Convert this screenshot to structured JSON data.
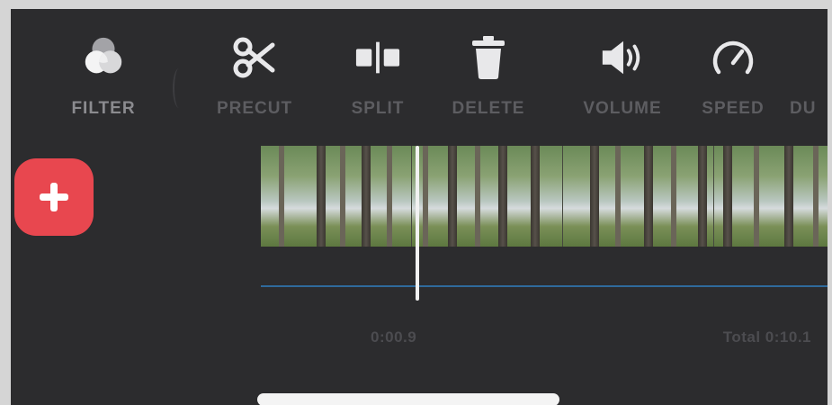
{
  "toolbar": {
    "tools": [
      {
        "label": "FILTER",
        "icon": "filter-icon"
      },
      {
        "label": "PRECUT",
        "icon": "scissors-icon"
      },
      {
        "label": "SPLIT",
        "icon": "split-icon"
      },
      {
        "label": "DELETE",
        "icon": "trash-icon"
      },
      {
        "label": "VOLUME",
        "icon": "speaker-icon"
      },
      {
        "label": "SPEED",
        "icon": "speedometer-icon"
      },
      {
        "label": "DU",
        "icon": "duration-icon"
      }
    ]
  },
  "add_button": {
    "icon": "plus-icon",
    "color": "#e8474f"
  },
  "timeline": {
    "current_time": "0:00.9",
    "total_time": "Total 0:10.1",
    "playhead_color": "#f2f2f2",
    "track_color": "#2f6a9c"
  },
  "colors": {
    "background": "#2c2c2e",
    "label": "#5d5d61",
    "accent": "#e8474f"
  }
}
